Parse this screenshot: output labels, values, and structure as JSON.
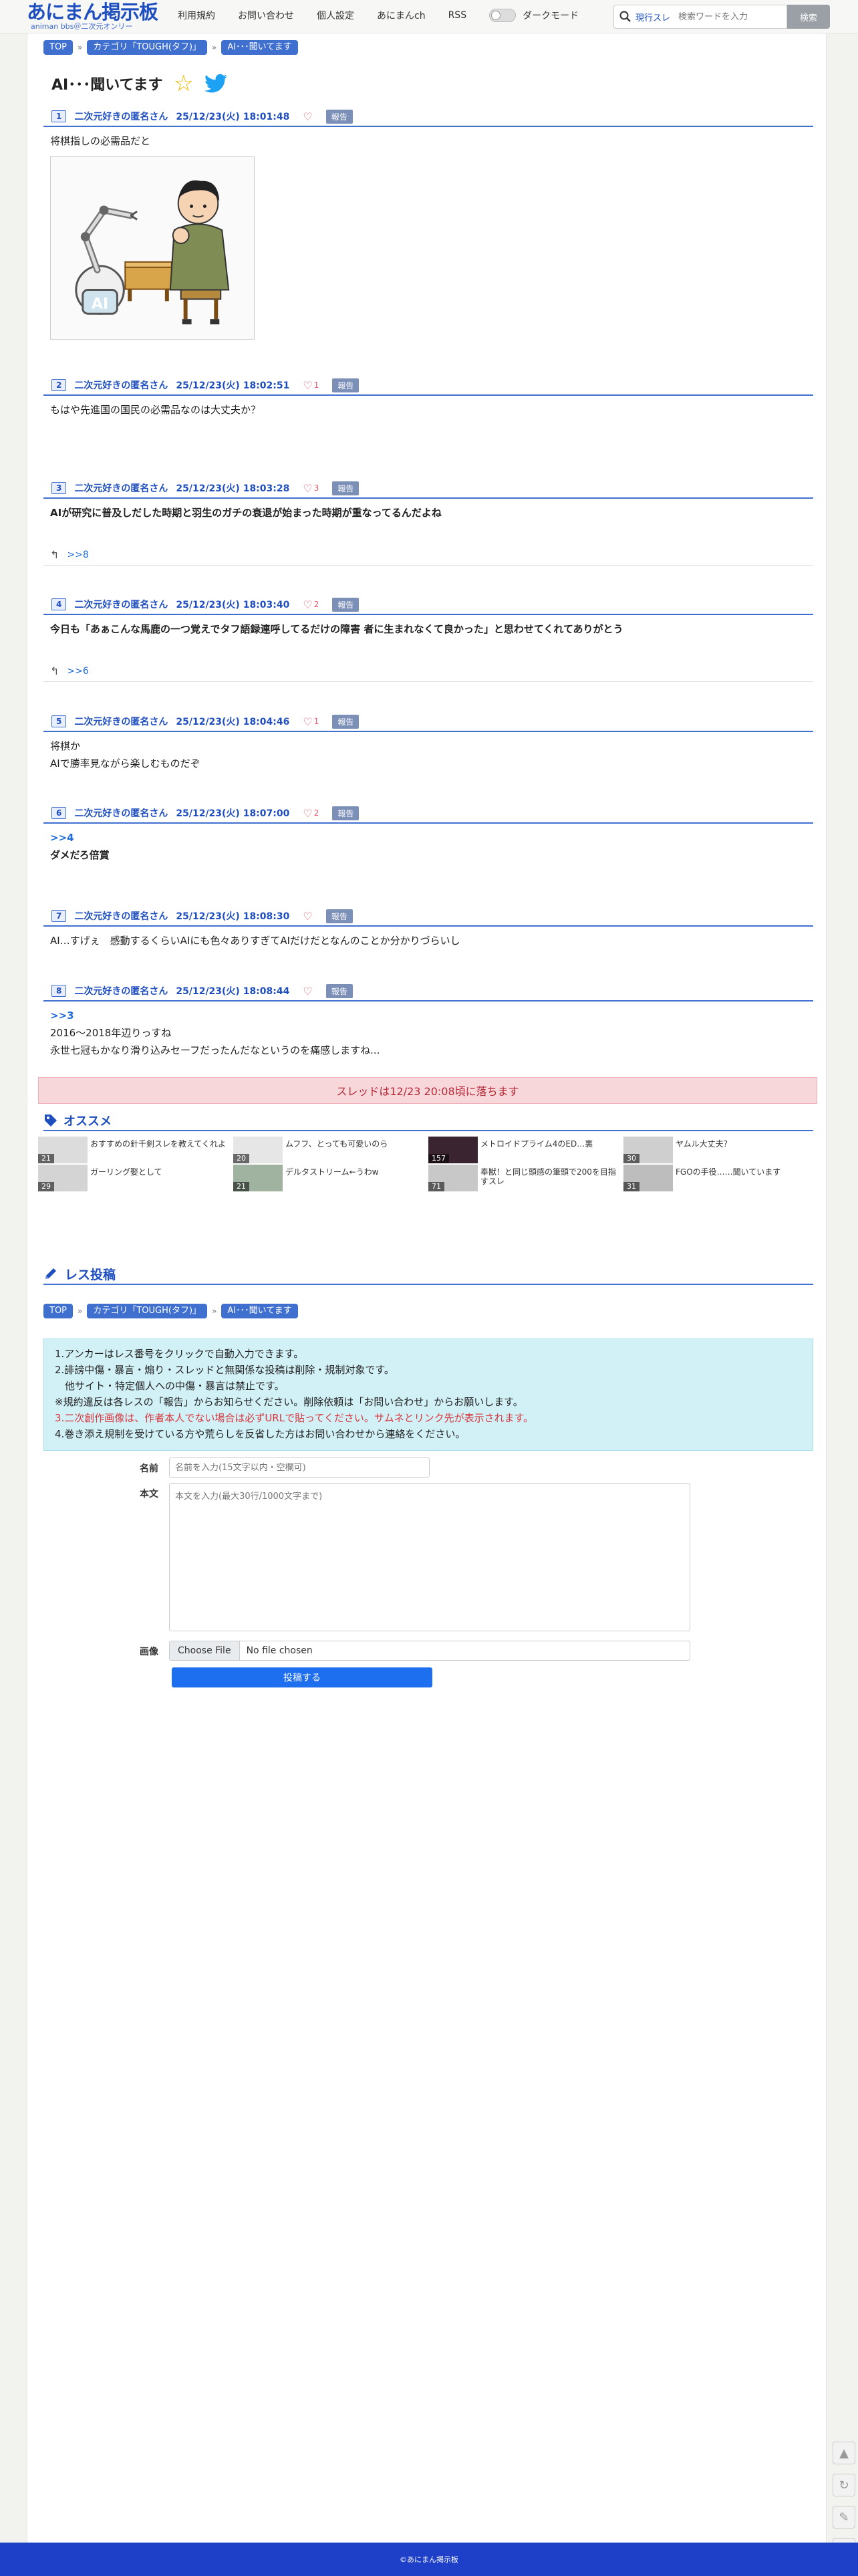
{
  "header": {
    "logo_main": "あにまん掲示板",
    "logo_sub": "animan bbs＠二次元オンリー",
    "nav": [
      "利用規約",
      "お問い合わせ",
      "個人設定",
      "あにまんch",
      "RSS"
    ],
    "dark_mode_label": "ダークモード",
    "search_scope": "現行スレ",
    "search_placeholder": "検索ワードを入力",
    "search_button": "検索"
  },
  "breadcrumb": [
    "TOP",
    "カテゴリ「TOUGH(タフ)」",
    "AI･･･聞いてます"
  ],
  "thread": {
    "title": "AI･･･聞いてます",
    "star_icon": "star-icon",
    "share_icon": "twitter-icon"
  },
  "posts": [
    {
      "num": "1",
      "name": "二次元好きの匿名さん",
      "date": "25/12/23(火) 18:01:48",
      "likes": "",
      "report": "報告",
      "lines": [
        "将棋指しの必需品だと"
      ],
      "bold": false,
      "has_image": true,
      "replies": ""
    },
    {
      "num": "2",
      "name": "二次元好きの匿名さん",
      "date": "25/12/23(火) 18:02:51",
      "likes": "1",
      "report": "報告",
      "lines": [
        "もはや先進国の国民の必需品なのは大丈夫か？"
      ],
      "bold": false,
      "replies": ""
    },
    {
      "num": "3",
      "name": "二次元好きの匿名さん",
      "date": "25/12/23(火) 18:03:28",
      "likes": "3",
      "report": "報告",
      "lines": [
        "AIが研究に普及しだした時期と羽生のガチの衰退が始まった時期が重なってるんだよね"
      ],
      "bold": true,
      "replies": ">>8"
    },
    {
      "num": "4",
      "name": "二次元好きの匿名さん",
      "date": "25/12/23(火) 18:03:40",
      "likes": "2",
      "report": "報告",
      "lines": [
        "今日も「あぁこんな馬鹿の一つ覚えでタフ語録連呼してるだけの障害 者に生まれなくて良かった」と思わせてくれてありがとう"
      ],
      "bold": true,
      "replies": ">>6"
    },
    {
      "num": "5",
      "name": "二次元好きの匿名さん",
      "date": "25/12/23(火) 18:04:46",
      "likes": "1",
      "report": "報告",
      "lines": [
        "将棋か",
        "AIで勝率見ながら楽しむものだぞ"
      ],
      "bold": false,
      "replies": ""
    },
    {
      "num": "6",
      "name": "二次元好きの匿名さん",
      "date": "25/12/23(火) 18:07:00",
      "likes": "2",
      "report": "報告",
      "anchor": ">>4",
      "lines": [
        "ダメだろ倍賞"
      ],
      "bold": true,
      "replies": ""
    },
    {
      "num": "7",
      "name": "二次元好きの匿名さん",
      "date": "25/12/23(火) 18:08:30",
      "likes": "",
      "report": "報告",
      "lines": [
        "AI…すげぇ　感動するくらいAIにも色々ありすぎてAIだけだとなんのことか分かりづらいし"
      ],
      "bold": false,
      "replies": ""
    },
    {
      "num": "8",
      "name": "二次元好きの匿名さん",
      "date": "25/12/23(火) 18:08:44",
      "likes": "",
      "report": "報告",
      "anchor": ">>3",
      "lines": [
        "2016〜2018年辺りっすね",
        "永世七冠もかなり滑り込みセーフだったんだなというのを痛感しますね..."
      ],
      "bold": false,
      "replies": ""
    }
  ],
  "closed_notice": "スレッドは12/23 20:08頃に落ちます",
  "recommend": {
    "heading": "オススメ",
    "items": [
      {
        "title": "おすすめの針千剣スレを教えてくれよ",
        "count": "21"
      },
      {
        "title": "ムフフ、とっても可愛いのら",
        "count": "20"
      },
      {
        "title": "メトロイドプライム4のED…裏",
        "count": "157"
      },
      {
        "title": "ヤムル大丈夫？",
        "count": "30"
      },
      {
        "title": "ガーリング娶として",
        "count": "29"
      },
      {
        "title": "デルタストリーム←うわw",
        "count": "21"
      },
      {
        "title": "奉獣！と同じ頭感の筆頭で200を目指すスレ",
        "count": "71"
      },
      {
        "title": "FGOの手役……聞いています",
        "count": "31"
      }
    ]
  },
  "post_form": {
    "heading": "レス投稿",
    "rules": [
      "1.アンカーはレス番号をクリックで自動入力できます。",
      "2.誹謗中傷・暴言・煽り・スレッドと無関係な投稿は削除・規制対象です。",
      "　他サイト・特定個人への中傷・暴言は禁止です。",
      "※規約違反は各レスの「報告」からお知らせください。削除依頼は「お問い合わせ」からお願いします。",
      "3.二次創作画像は、作者本人でない場合は必ずURLで貼ってください。サムネとリンク先が表示されます。",
      "4.巻き添え規制を受けている方や荒らしを反省した方はお問い合わせから連絡をください。"
    ],
    "name_label": "名前",
    "name_placeholder": "名前を入力(15文字以内・空欄可)",
    "body_label": "本文",
    "body_placeholder": "本文を入力(最大30行/1000文字まで)",
    "image_label": "画像",
    "file_button": "Choose File",
    "file_status": "No file chosen",
    "submit": "投稿する"
  },
  "footer": "©あにまん掲示板"
}
